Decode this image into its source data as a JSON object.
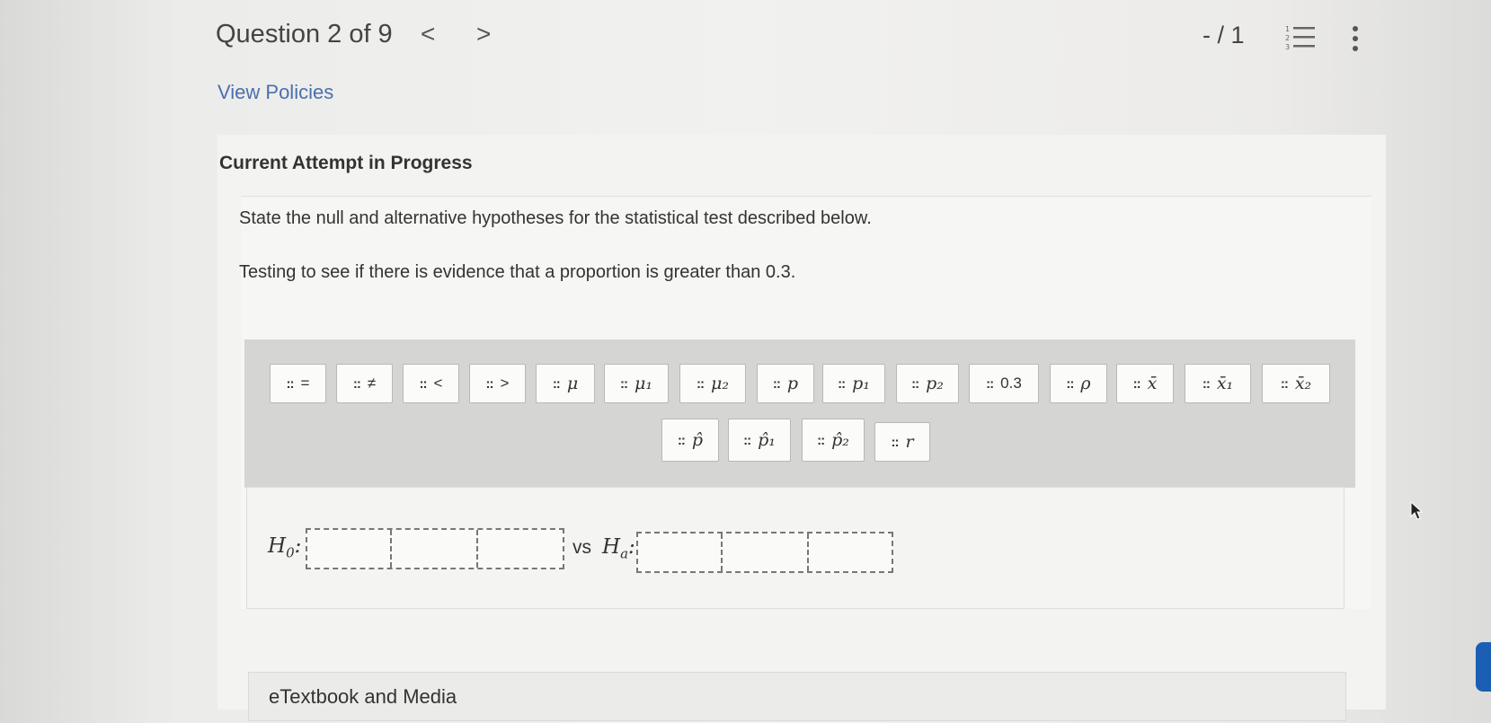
{
  "header": {
    "question_title": "Question 2 of 9",
    "prev_icon": "chevron-left-icon",
    "next_icon": "chevron-right-icon",
    "prev_glyph": "<",
    "next_glyph": ">",
    "score": "- / 1",
    "list_icon": "numbered-list-icon",
    "more_icon": "vertical-ellipsis-icon"
  },
  "links": {
    "view_policies": "View Policies"
  },
  "attempt": {
    "title": "Current Attempt in Progress",
    "prompt_line_1": "State the null and alternative hypotheses for the statistical test described below.",
    "prompt_line_2": "Testing to see if there is evidence that a proportion is greater than 0.3."
  },
  "palette": {
    "grip_glyph": "::",
    "row1": [
      "=",
      "≠",
      "<",
      ">",
      "μ",
      "μ₁",
      "μ₂",
      "p",
      "p₁",
      "p₂",
      "0.3",
      "ρ",
      "x̄",
      "x̄₁",
      "x̄₂"
    ],
    "row2": [
      "p̂",
      "p̂₁",
      "p̂₂",
      "r"
    ]
  },
  "answer": {
    "h0_label": "H",
    "h0_sub": "0",
    "h0_colon": ":",
    "vs_label": "vs",
    "ha_label": "H",
    "ha_sub": "a",
    "ha_colon": ":"
  },
  "footer": {
    "etextbook": "eTextbook and Media"
  }
}
